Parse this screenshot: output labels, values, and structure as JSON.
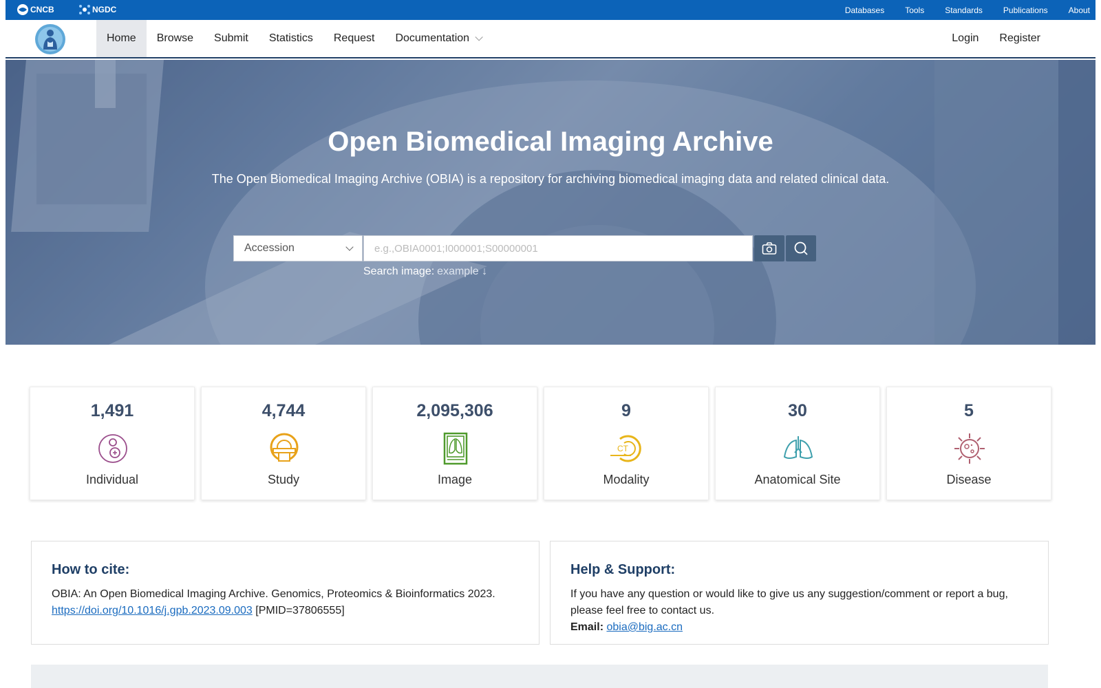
{
  "topbar": {
    "brands": [
      "CNCB",
      "NGDC"
    ],
    "links": [
      "Databases",
      "Tools",
      "Standards",
      "Publications",
      "About"
    ]
  },
  "nav": {
    "items": [
      {
        "label": "Home",
        "active": true
      },
      {
        "label": "Browse"
      },
      {
        "label": "Submit"
      },
      {
        "label": "Statistics"
      },
      {
        "label": "Request"
      },
      {
        "label": "Documentation",
        "dropdown": true
      }
    ],
    "login": "Login",
    "register": "Register"
  },
  "hero": {
    "title": "Open Biomedical Imaging Archive",
    "subtitle": "The Open Biomedical Imaging Archive (OBIA) is a repository for archiving biomedical imaging data and related clinical data.",
    "search": {
      "selected": "Accession",
      "placeholder": "e.g.,OBIA0001;I000001;S00000001"
    },
    "image_search_label": "Search image:",
    "image_search_example": "example ↓"
  },
  "stats": [
    {
      "value": "1,491",
      "label": "Individual",
      "icon": "individual-icon",
      "color": "#9b4e8c"
    },
    {
      "value": "4,744",
      "label": "Study",
      "icon": "study-icon",
      "color": "#e8a21a"
    },
    {
      "value": "2,095,306",
      "label": "Image",
      "icon": "image-icon",
      "color": "#4f9a2c"
    },
    {
      "value": "9",
      "label": "Modality",
      "icon": "ct-modality-icon",
      "color": "#e8b51a"
    },
    {
      "value": "30",
      "label": "Anatomical Site",
      "icon": "lungs-icon",
      "color": "#3fa0ad"
    },
    {
      "value": "5",
      "label": "Disease",
      "icon": "virus-icon",
      "color": "#b06070"
    }
  ],
  "cite": {
    "title": "How to cite:",
    "text": "OBIA: An Open Biomedical Imaging Archive. Genomics, Proteomics & Bioinformatics 2023.",
    "link": "https://doi.org/10.1016/j.gpb.2023.09.003",
    "pmid": "[PMID=37806555]"
  },
  "help": {
    "title": "Help & Support:",
    "text": "If you have any question or would like to give us any suggestion/comment or report a bug, please feel free to contact us.",
    "email_label": "Email:",
    "email": "obia@big.ac.cn"
  }
}
